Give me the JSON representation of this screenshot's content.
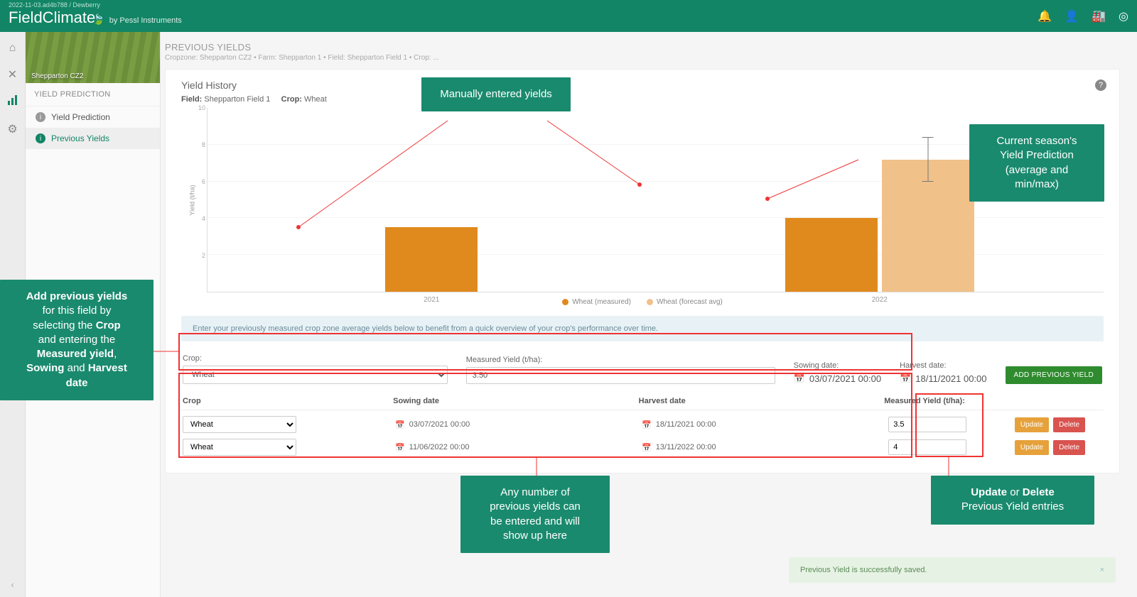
{
  "build_tag": "2022-11-03.ad4b788 / Dewberry",
  "brand": {
    "name": "FieldClimate",
    "by": "by Pessl Instruments"
  },
  "sidebar": {
    "image_caption": "Shepparton CZ2",
    "section": "YIELD PREDICTION",
    "items": [
      {
        "label": "Yield Prediction",
        "active": false
      },
      {
        "label": "Previous Yields",
        "active": true
      }
    ]
  },
  "header": {
    "title": "PREVIOUS YIELDS",
    "breadcrumb": "Cropzone: Shepparton CZ2 • Farm: Shepparton 1 • Field: Shepparton Field 1 • Crop: ..."
  },
  "card": {
    "title": "Yield History",
    "field_label": "Field:",
    "field_value": "Shepparton Field 1",
    "crop_label": "Crop:",
    "crop_value": "Wheat"
  },
  "chart_data": {
    "type": "bar",
    "ylabel": "Yield (t/ha)",
    "ylim": [
      0,
      10
    ],
    "yticks": [
      2,
      4,
      6,
      8,
      10
    ],
    "categories": [
      "2021",
      "2022"
    ],
    "series": [
      {
        "name": "Wheat (measured)",
        "color": "#e08a1e",
        "values": [
          3.5,
          4.0
        ]
      },
      {
        "name": "Wheat (forecast avg)",
        "color": "#f1c18a",
        "values": [
          null,
          7.2
        ],
        "error": [
          null,
          {
            "min": 6.0,
            "max": 8.4
          }
        ]
      }
    ]
  },
  "legend": [
    {
      "label": "Wheat (measured)",
      "color": "#e08a1e"
    },
    {
      "label": "Wheat (forecast avg)",
      "color": "#f1c18a"
    }
  ],
  "info_text": "Enter your previously measured crop zone average yields below to benefit from a quick overview of your crop's performance over time.",
  "form": {
    "crop_label": "Crop:",
    "crop_value": "Wheat",
    "my_label": "Measured Yield (t/ha):",
    "my_value": "3.50",
    "sow_label": "Sowing date:",
    "sow_value": "03/07/2021 00:00",
    "harv_label": "Harvest date:",
    "harv_value": "18/11/2021 00:00",
    "add_btn": "ADD PREVIOUS YIELD"
  },
  "table": {
    "headers": {
      "crop": "Crop",
      "sowing": "Sowing date",
      "harvest": "Harvest date",
      "yield": "Measured Yield (t/ha):"
    },
    "rows": [
      {
        "crop": "Wheat",
        "sowing": "03/07/2021 00:00",
        "harvest": "18/11/2021 00:00",
        "yield": "3.5"
      },
      {
        "crop": "Wheat",
        "sowing": "11/06/2022 00:00",
        "harvest": "13/11/2022 00:00",
        "yield": "4"
      }
    ],
    "update": "Update",
    "delete": "Delete"
  },
  "toast": "Previous Yield is successfully saved.",
  "callouts": {
    "manual": "Manually entered yields",
    "current_title": "Current season's",
    "current_l2": "Yield Prediction",
    "current_l3": "(average and",
    "current_l4": "min/max)",
    "add_1": "Add previous yields",
    "add_2": "for this field by",
    "add_3": "selecting the ",
    "add_3b": "Crop",
    "add_4": "and entering the",
    "add_5": "Measured yield",
    "add_6": "Sowing",
    "add_6b": " and ",
    "add_6c": "Harvest",
    "add_7": "date",
    "rows_1": "Any number of",
    "rows_2": "previous yields can",
    "rows_3": "be entered and will",
    "rows_4": "show up here",
    "ud_1": "Update",
    "ud_1b": " or ",
    "ud_1c": "Delete",
    "ud_2": "Previous Yield entries"
  }
}
